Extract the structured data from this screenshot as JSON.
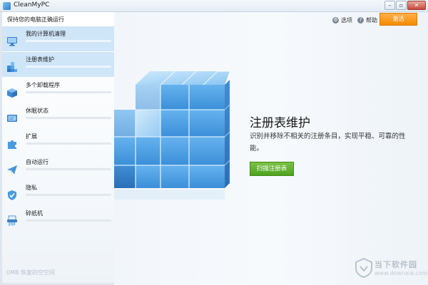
{
  "window": {
    "title": "CleanMyPC",
    "controls": [
      "–",
      "▫",
      "✕"
    ]
  },
  "sidebar": {
    "status": "保持您的电脑正确运行",
    "items": [
      {
        "label": "我的计算机清理",
        "icon": "computer-icon",
        "active": true
      },
      {
        "label": "注册表维护",
        "icon": "registry-cube-icon",
        "active": true
      },
      {
        "label": "多个卸载程序",
        "icon": "uninstaller-box-icon",
        "active": false
      },
      {
        "label": "休眠状态",
        "icon": "hibernation-icon",
        "active": false
      },
      {
        "label": "扩展",
        "icon": "puzzle-icon",
        "active": false
      },
      {
        "label": "自动运行",
        "icon": "paper-plane-icon",
        "active": false
      },
      {
        "label": "隐私",
        "icon": "shield-icon",
        "active": false
      },
      {
        "label": "碎纸机",
        "icon": "shredder-icon",
        "active": false
      }
    ],
    "freed_space": "0MB 恢复的空空间"
  },
  "header": {
    "options_label": "选项",
    "help_label": "帮助",
    "activate_label": "激活"
  },
  "main": {
    "title": "注册表维护",
    "description": "识别并移除不相关的注册条目，实现平稳、可靠的性能。",
    "scan_button": "扫描注册表"
  },
  "watermark": {
    "text": "当下软件园",
    "url": "www.downxia.com"
  },
  "colors": {
    "accent_blue": "#cfe5f8",
    "activate": "#f48a00",
    "scan": "#4ea321",
    "cube": "#4a9be0"
  }
}
